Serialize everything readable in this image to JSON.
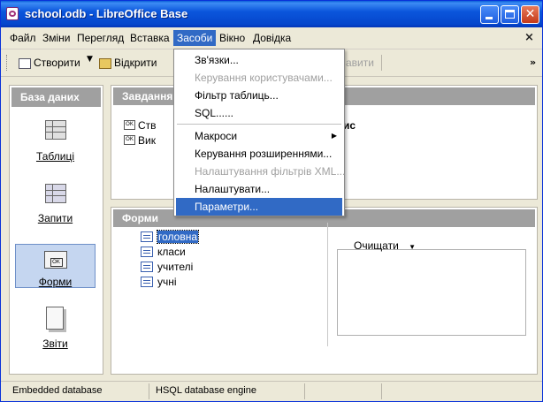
{
  "window": {
    "title": "school.odb - LibreOffice Base"
  },
  "menubar": {
    "items": [
      "Файл",
      "Зміни",
      "Перегляд",
      "Вставка",
      "Засоби",
      "Вікно",
      "Довідка"
    ],
    "close_glyph": "×"
  },
  "toolbar": {
    "create_label": "Створити",
    "open_label": "Відкрити",
    "hidden_label": "авити",
    "more_glyph": "»"
  },
  "left_pane": {
    "header": "База даних",
    "items": [
      {
        "label": "Таблиці",
        "icon": "tables-icon"
      },
      {
        "label": "Запити",
        "icon": "queries-icon"
      },
      {
        "label": "Форми",
        "icon": "forms-icon",
        "selected": true
      },
      {
        "label": "Звіти",
        "icon": "reports-icon"
      }
    ]
  },
  "tasks_panel": {
    "header": "Завдання",
    "tasks": [
      "Ств",
      "Вик"
    ],
    "right_fragment": "ис"
  },
  "forms_panel": {
    "header": "Форми",
    "forms": [
      "головна",
      "класи",
      "учителі",
      "учні"
    ],
    "selected_form": "головна",
    "preview_select": "Очищати"
  },
  "statusbar": {
    "db_type": "Embedded database",
    "engine": "HSQL database engine"
  },
  "tools_menu": {
    "items": [
      {
        "label": "Зв'язки...",
        "disabled": false
      },
      {
        "label": "Керування користувачами...",
        "disabled": true
      },
      {
        "label": "Фільтр таблиць...",
        "disabled": false
      },
      {
        "label": "SQL......",
        "disabled": false
      },
      {
        "label": "Макроси",
        "disabled": false,
        "submenu": true
      },
      {
        "label": "Керування розширеннями...",
        "disabled": false
      },
      {
        "label": "Налаштування фільтрів XML...",
        "disabled": true
      },
      {
        "label": "Налаштувати...",
        "disabled": false
      },
      {
        "label": "Параметри...",
        "disabled": false,
        "highlighted": true
      }
    ]
  }
}
